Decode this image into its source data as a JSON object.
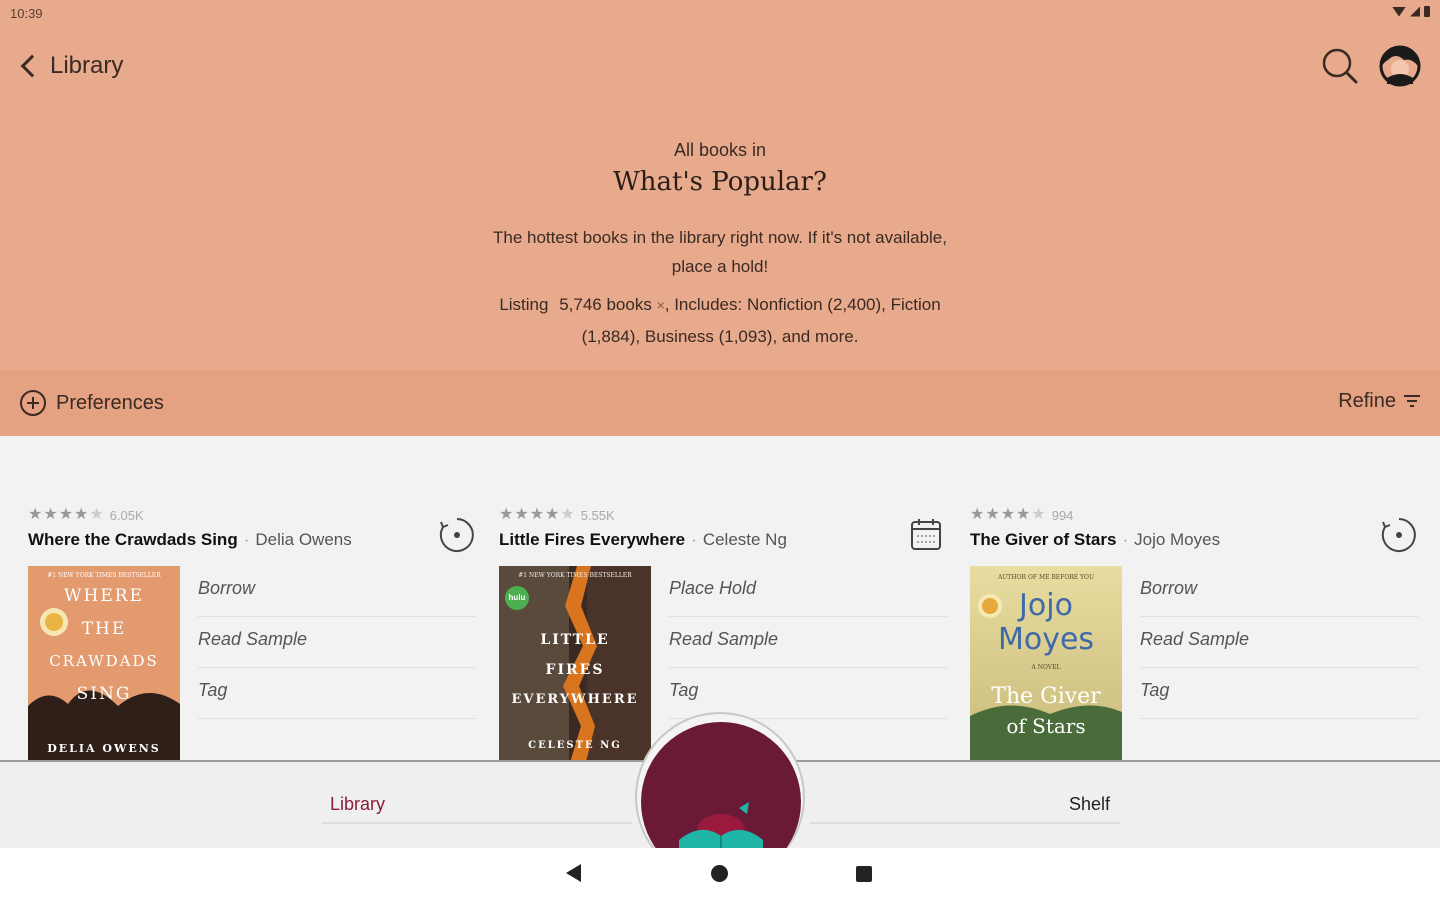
{
  "status": {
    "time": "10:39"
  },
  "header": {
    "back_label": "Library"
  },
  "intro": {
    "kicker": "All books in",
    "title": "What's Popular?",
    "description": "The hottest books in the library right now. If it's not available, place a hold!",
    "listing_prefix": "Listing",
    "listing_count": "5,746 books",
    "listing_remove": "×",
    "listing_includes": ", Includes: Nonfiction (2,400), Fiction (1,884), Business (1,093), and more."
  },
  "toolbar": {
    "preferences_label": "Preferences",
    "refine_label": "Refine"
  },
  "books": [
    {
      "rating_stars": 4.5,
      "rating_count": "6.05K",
      "title": "Where the Crawdads Sing",
      "author": "Delia Owens",
      "status_icon": "borrow-plus-icon",
      "actions": [
        "Borrow",
        "Read Sample",
        "Tag"
      ],
      "cover": {
        "top_text": "#1 NEW YORK TIMES BESTSELLER",
        "title_lines": [
          "WHERE",
          "THE",
          "CRAWDADS",
          "SING"
        ],
        "author_text": "DELIA OWENS",
        "bg": "#e39a6e",
        "accent": "#2e2018"
      }
    },
    {
      "rating_stars": 4,
      "rating_count": "5.55K",
      "title": "Little Fires Everywhere",
      "author": "Celeste Ng",
      "status_icon": "calendar-hold-icon",
      "actions": [
        "Place Hold",
        "Read Sample",
        "Tag"
      ],
      "cover": {
        "top_text": "#1 NEW YORK TIMES BESTSELLER",
        "title_lines": [
          "LITTLE",
          "FIRES",
          "EVERYWHERE"
        ],
        "author_text": "CELESTE NG",
        "badge_text": "hulu",
        "bg": "#3a2a22",
        "accent": "#d9741f"
      }
    },
    {
      "rating_stars": 4,
      "rating_count": "994",
      "title": "The Giver of Stars",
      "author": "Jojo Moyes",
      "status_icon": "borrow-plus-icon",
      "actions": [
        "Borrow",
        "Read Sample",
        "Tag"
      ],
      "cover": {
        "top_text": "AUTHOR OF ME BEFORE YOU",
        "title_lines": [
          "Jojo",
          "Moyes"
        ],
        "subtitle_lines": [
          "The Giver",
          "of Stars"
        ],
        "tag_text": "A NOVEL",
        "bg": "#d9c88a",
        "accent": "#4a6b3a"
      }
    }
  ],
  "bottom_nav": {
    "library_label": "Library",
    "shelf_label": "Shelf"
  },
  "colors": {
    "header_bg": "#e8aa8c",
    "toolbar_bg": "#e4a282",
    "brand": "#6b1a36",
    "accent_teal": "#1fb5a7"
  }
}
